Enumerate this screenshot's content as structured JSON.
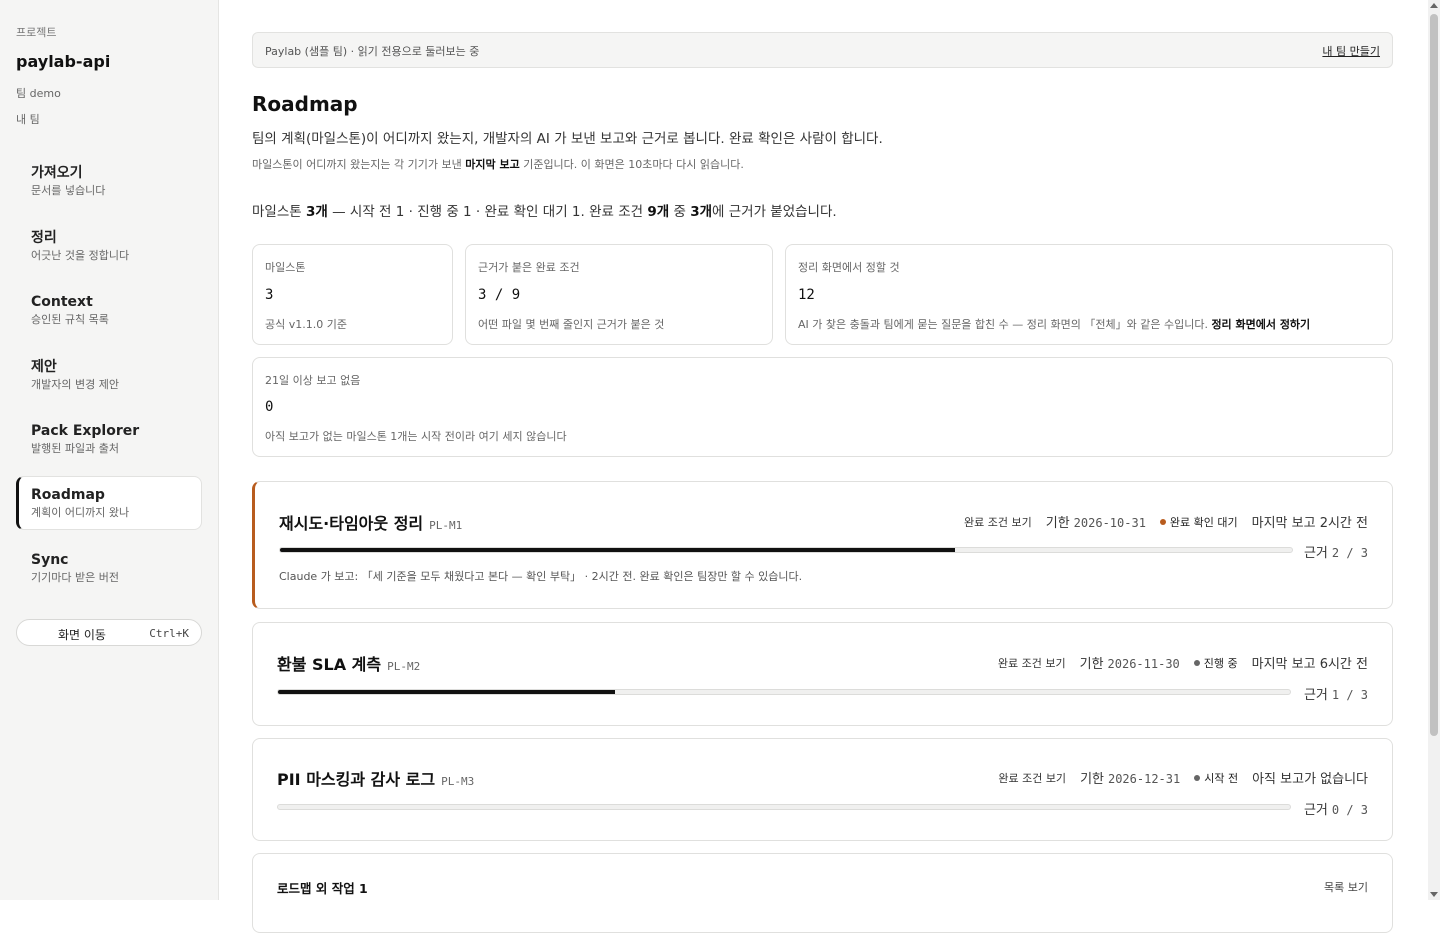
{
  "sidebar": {
    "caption": "프로젝트",
    "project": "paylab-api",
    "team": "팀 demo",
    "my_team": "내 팀",
    "items": [
      {
        "label": "가져오기",
        "sub": "문서를 넣습니다"
      },
      {
        "label": "정리",
        "sub": "어긋난 것을 정합니다"
      },
      {
        "label": "Context",
        "sub": "승인된 규칙 목록"
      },
      {
        "label": "제안",
        "sub": "개발자의 변경 제안"
      },
      {
        "label": "Pack Explorer",
        "sub": "발행된 파일과 출처"
      },
      {
        "label": "Roadmap",
        "sub": "계획이 어디까지 왔나"
      },
      {
        "label": "Sync",
        "sub": "기기마다 받은 버전"
      }
    ],
    "active_item": "Roadmap",
    "jump_label": "화면 이동",
    "jump_shortcut": "Ctrl+K"
  },
  "banner": {
    "text": "Paylab (샘플 팀) · 읽기 전용으로 둘러보는 중",
    "link": "내 팀 만들기"
  },
  "page": {
    "title": "Roadmap",
    "intro": "팀의 계획(마일스톤)이 어디까지 왔는지, 개발자의 AI 가 보낸 보고와 근거로 봅니다. 완료 확인은 사람이 합니다.",
    "note_before": "마일스톤이 어디까지 왔는지는 각 기기가 보낸 ",
    "note_bold": "마지막 보고",
    "note_after": " 기준입니다. 이 화면은 10초마다 다시 읽습니다."
  },
  "summary": {
    "s1": "마일스톤 ",
    "b1": "3개",
    "s2": " — 시작 전 1 · 진행 중 1 · 완료 확인 대기 1. 완료 조건 ",
    "b2": "9개",
    "s3": " 중 ",
    "b3": "3개",
    "s4": "에 근거가 붙었습니다."
  },
  "stats": [
    {
      "label": "마일스톤",
      "value": "3",
      "desc": "공식 v1.1.0 기준"
    },
    {
      "label": "근거가 붙은 완료 조건",
      "value": "3 / 9",
      "desc": "어떤 파일 몇 번째 줄인지 근거가 붙은 것"
    },
    {
      "label": "정리 화면에서 정할 것",
      "value": "12",
      "desc": "AI 가 찾은 충돌과 팀에게 묻는 질문을 합친 수 — 정리 화면의 「전체」와 같은 수입니다. ",
      "desc_link": "정리 화면에서 정하기"
    },
    {
      "label": "21일 이상 보고 없음",
      "value": "0",
      "desc": "아직 보고가 없는 마일스톤 1개는 시작 전이라 여기 세지 않습니다"
    }
  ],
  "milestones": [
    {
      "title": "재시도·타임아웃 정리",
      "code": "PL-M1",
      "criteria_link": "완료 조건 보기",
      "due_label": "기한",
      "due": "2026-10-31",
      "status": "완료 확인 대기",
      "status_color": "#b85c1e",
      "last_report": "마지막 보고 2시간 전",
      "evidence_label": "근거",
      "evidence": "2 / 3",
      "progress": 0.667,
      "report": "Claude 가 보고: 「세 기준을 모두 채웠다고 본다 — 확인 부탁」 · 2시간 전. 완료 확인은 팀장만 할 수 있습니다."
    },
    {
      "title": "환불 SLA 계측",
      "code": "PL-M2",
      "criteria_link": "완료 조건 보기",
      "due_label": "기한",
      "due": "2026-11-30",
      "status": "진행 중",
      "status_color": "#666666",
      "last_report": "마지막 보고 6시간 전",
      "evidence_label": "근거",
      "evidence": "1 / 3",
      "progress": 0.333
    },
    {
      "title": "PII 마스킹과 감사 로그",
      "code": "PL-M3",
      "criteria_link": "완료 조건 보기",
      "due_label": "기한",
      "due": "2026-12-31",
      "status": "시작 전",
      "status_color": "#666666",
      "last_report": "아직 보고가 없습니다",
      "evidence_label": "근거",
      "evidence": "0 / 3",
      "progress": 0
    }
  ],
  "extra": {
    "title": "로드맵 외 작업 1",
    "link": "목록 보기"
  }
}
